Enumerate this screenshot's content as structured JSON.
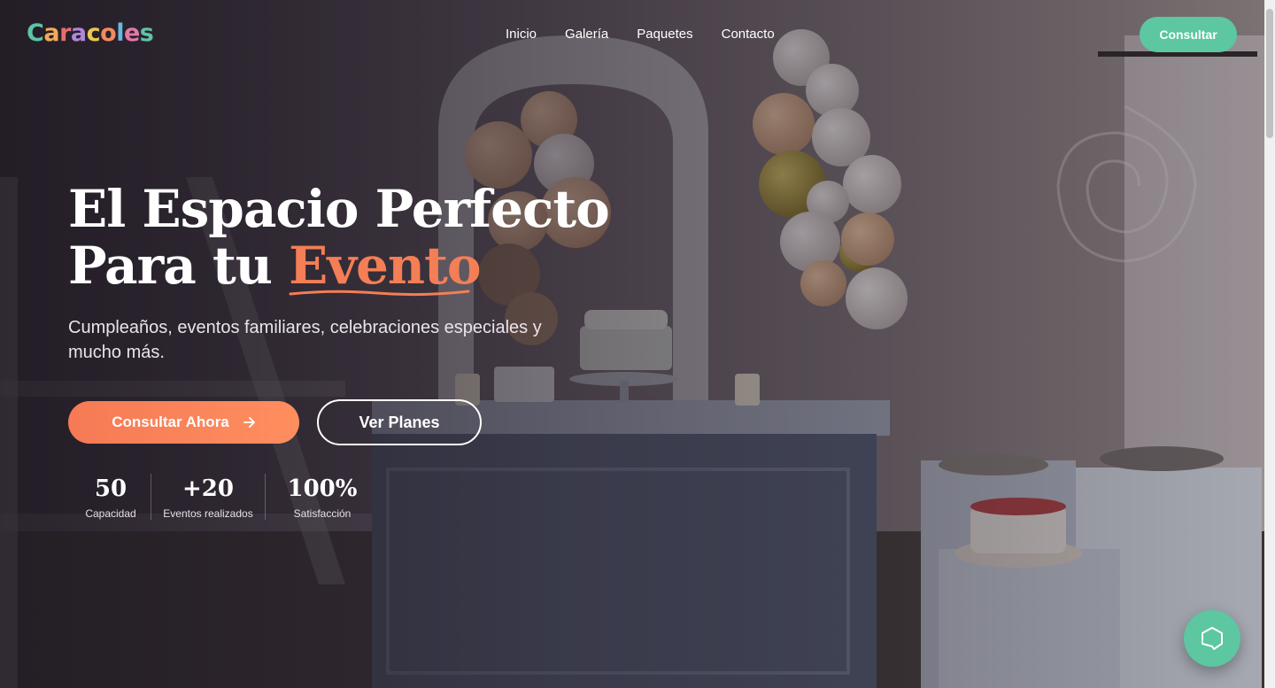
{
  "brand": {
    "letters": [
      {
        "ch": "C",
        "color": "#5fc4a6"
      },
      {
        "ch": "a",
        "color": "#f4a95a"
      },
      {
        "ch": "r",
        "color": "#e86d6d"
      },
      {
        "ch": "a",
        "color": "#b286d8"
      },
      {
        "ch": "c",
        "color": "#e8c94f"
      },
      {
        "ch": "o",
        "color": "#f28a5f"
      },
      {
        "ch": "l",
        "color": "#6ab8e0"
      },
      {
        "ch": "e",
        "color": "#e07aa6"
      },
      {
        "ch": "s",
        "color": "#5fc4a6"
      }
    ]
  },
  "nav": {
    "items": [
      "Inicio",
      "Galería",
      "Paquetes",
      "Contacto"
    ]
  },
  "header": {
    "cta_label": "Consultar"
  },
  "hero": {
    "title_line1": "El Espacio Perfecto",
    "title_line2_prefix": "Para tu ",
    "title_line2_accent": "Evento",
    "subtitle": "Cumpleaños, eventos familiares, celebraciones especiales y mucho más.",
    "primary_cta": "Consultar Ahora",
    "secondary_cta": "Ver Planes"
  },
  "stats": [
    {
      "value": "50",
      "label": "Capacidad"
    },
    {
      "value": "+20",
      "label": "Eventos realizados"
    },
    {
      "value": "100%",
      "label": "Satisfacción"
    }
  ],
  "colors": {
    "accent": "#f47e56",
    "brand_green": "#5cc7a0",
    "text": "#ffffff"
  },
  "icons": {
    "primary_cta_icon": "arrow-right-icon",
    "chat_icon": "chat-bubble-icon"
  }
}
